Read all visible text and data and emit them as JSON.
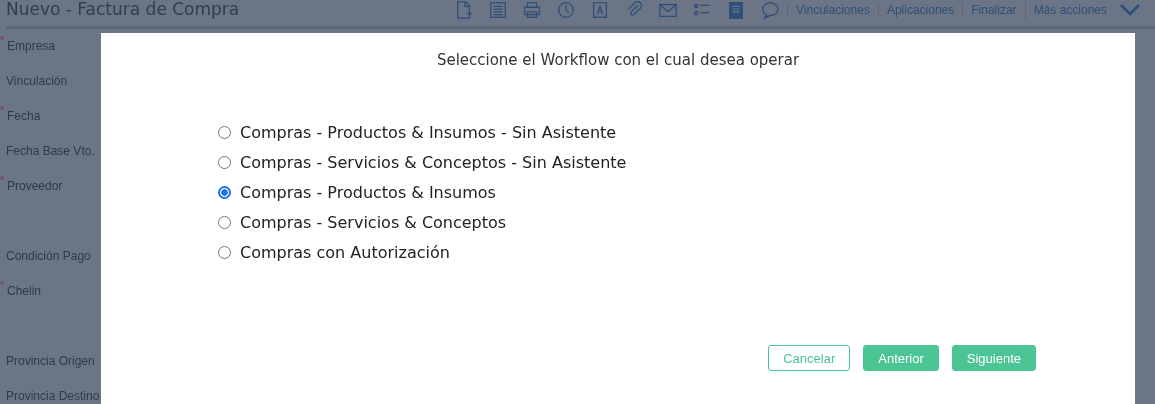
{
  "page": {
    "title": "Nuevo - Factura de Compra",
    "toolbar_links": [
      "Vinculaciones",
      "Aplicaciones",
      "Finalizar",
      "Más acciones"
    ],
    "fields": [
      {
        "label": "Empresa",
        "asterisk": "*"
      },
      {
        "label": "Vinculación"
      },
      {
        "label": "Fecha",
        "asterisk": "*"
      },
      {
        "label": "Fecha Base Vto."
      },
      {
        "label": "Proveedor",
        "asterisk": "*",
        "tall": true
      },
      {
        "label": "Condición Pago"
      },
      {
        "label": "Chelin",
        "asterisk": "*",
        "tall": true
      },
      {
        "label": "Provincia Origen"
      },
      {
        "label": "Provincia Destino"
      }
    ]
  },
  "dialog": {
    "title": "Seleccione el Workflow con el cual desea operar",
    "options": [
      {
        "label": "Compras - Productos & Insumos - Sin Asistente",
        "selected": false
      },
      {
        "label": "Compras - Servicios & Conceptos - Sin Asistente",
        "selected": false
      },
      {
        "label": "Compras - Productos & Insumos",
        "selected": true
      },
      {
        "label": "Compras - Servicios & Conceptos",
        "selected": false
      },
      {
        "label": "Compras con Autorización",
        "selected": false
      }
    ],
    "buttons": [
      {
        "label": "Cancelar",
        "kind": "outline"
      },
      {
        "label": "Anterior",
        "kind": "filled"
      },
      {
        "label": "Siguiente",
        "kind": "filled"
      }
    ]
  }
}
